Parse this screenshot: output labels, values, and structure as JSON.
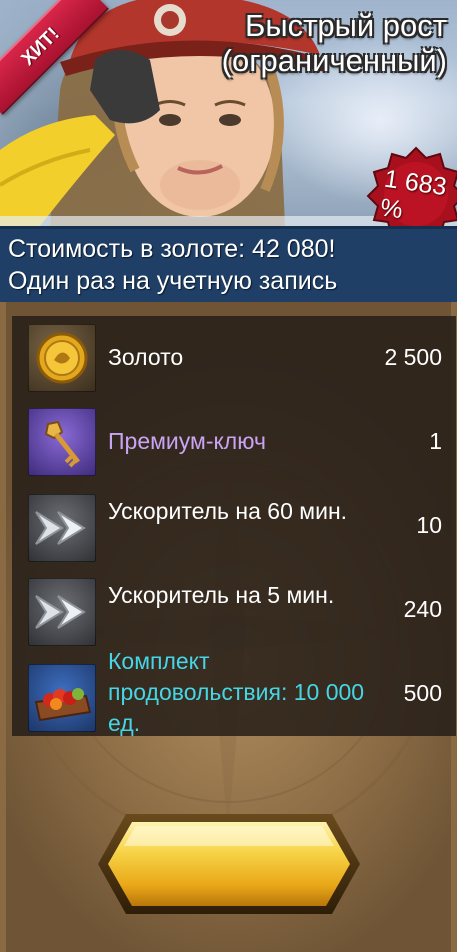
{
  "banner": {
    "badge": "ХИТ!",
    "title_line1": "Быстрый рост",
    "title_line2": "(ограниченный)",
    "discount": "1 683 %"
  },
  "info": {
    "cost_text": "Стоимость в золоте: 42 080!",
    "limit_text": "Один раз на учетную запись"
  },
  "items": [
    {
      "name": "Золото",
      "qty": "2 500",
      "icon": "gold-coin-icon"
    },
    {
      "name": "Премиум-ключ",
      "qty": "1",
      "icon": "premium-key-icon",
      "color": "#c9a4f2"
    },
    {
      "name": "Ускоритель на 60 мин.",
      "qty": "10",
      "icon": "speedup-arrows-icon"
    },
    {
      "name": "Ускоритель на 5 мин.",
      "qty": "240",
      "icon": "speedup-arrows-icon"
    },
    {
      "name": "Комплект продовольствия: 10 000 ед.",
      "qty": "500",
      "icon": "food-crate-icon",
      "color": "#45d6e6"
    }
  ],
  "colors": {
    "info_bar": "#1f3f66",
    "button_gold": "#f2c230",
    "badge_red": "#c01a3c"
  }
}
